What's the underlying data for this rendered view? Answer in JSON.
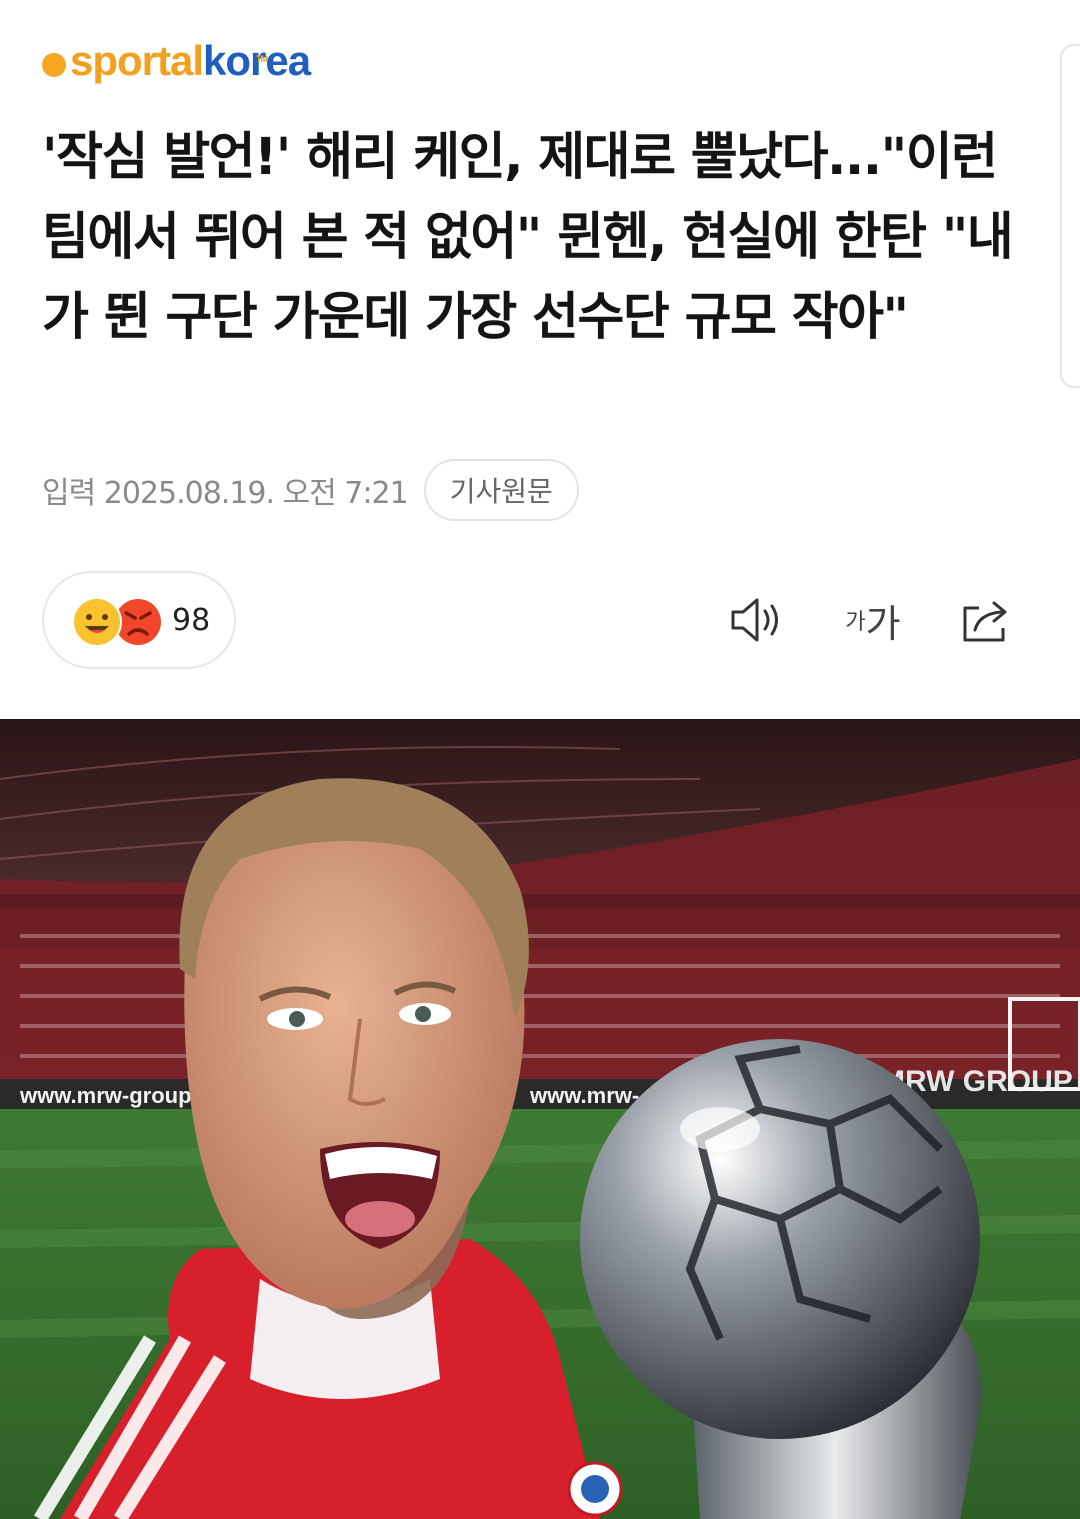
{
  "brand": {
    "part1": "sportal",
    "part2": "korea",
    "tm": "TM"
  },
  "article": {
    "title": "'작심 발언!' 해리 케인, 제대로 뿔났다...\"이런 팀에서 뛰어 본 적 없어\" 뮌헨, 현실에 한탄 \"내가 뛴 구단 가운데 가장 선수단 규모 작아\"",
    "published": "입력 2025.08.19. 오전 7:21",
    "source_button": "기사원문"
  },
  "reactions": {
    "count": "98",
    "icons": [
      "smile-emoji-icon",
      "angry-emoji-icon"
    ]
  },
  "toolbar": {
    "font_size_small": "가",
    "font_size_large": "가",
    "icons": [
      "speaker-icon",
      "font-size-icon",
      "share-icon"
    ]
  },
  "photo": {
    "ad_board_1": "www.mrw-group",
    "ad_board_2": "www.mrw-",
    "ad_board_3": "MRW GROUP"
  },
  "colors": {
    "brand_orange": "#f2a01e",
    "brand_blue": "#1f5fbf",
    "meta_gray": "#8a8a8a"
  }
}
